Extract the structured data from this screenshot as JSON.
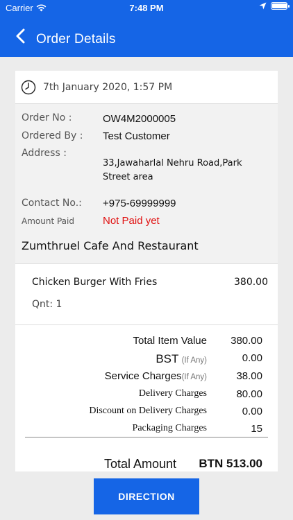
{
  "status_bar": {
    "carrier": "Carrier",
    "time": "7:48 PM"
  },
  "header": {
    "title": "Order Details",
    "back_icon": "chevron-left-icon"
  },
  "order": {
    "date": "7th January 2020, 1:57 PM",
    "order_no_label": "Order No :",
    "order_no": "OW4M2000005",
    "ordered_by_label": "Ordered By :",
    "ordered_by": "Test Customer",
    "address_label": "Address :",
    "address": "33,Jawaharlal Nehru Road,Park Street area",
    "contact_label": "Contact No.:",
    "contact": "+975-69999999",
    "amount_paid_label": "Amount Paid",
    "amount_paid_status": "Not Paid yet",
    "restaurant": "Zumthruel Cafe And Restaurant"
  },
  "items": [
    {
      "name": "Chicken Burger With Fries",
      "price": "380.00",
      "qty": "Qnt: 1"
    }
  ],
  "totals": {
    "total_item_value_label": "Total Item Value",
    "total_item_value": "380.00",
    "bst_label": "BST",
    "bst_hint": "(If Any)",
    "bst": "0.00",
    "service_label": "Service Charges",
    "service_hint": "(If Any)",
    "service": "38.00",
    "delivery_label": "Delivery Charges",
    "delivery": "80.00",
    "discount_label": "Discount on Delivery Charges",
    "discount": "0.00",
    "packaging_label": "Packaging Charges",
    "packaging": "15",
    "total_amount_label": "Total Amount",
    "total_amount": "BTN 513.00"
  },
  "actions": {
    "direction_label": "DIRECTION"
  },
  "colors": {
    "primary": "#1565e6",
    "unpaid": "#e01010",
    "background": "#ececec"
  }
}
